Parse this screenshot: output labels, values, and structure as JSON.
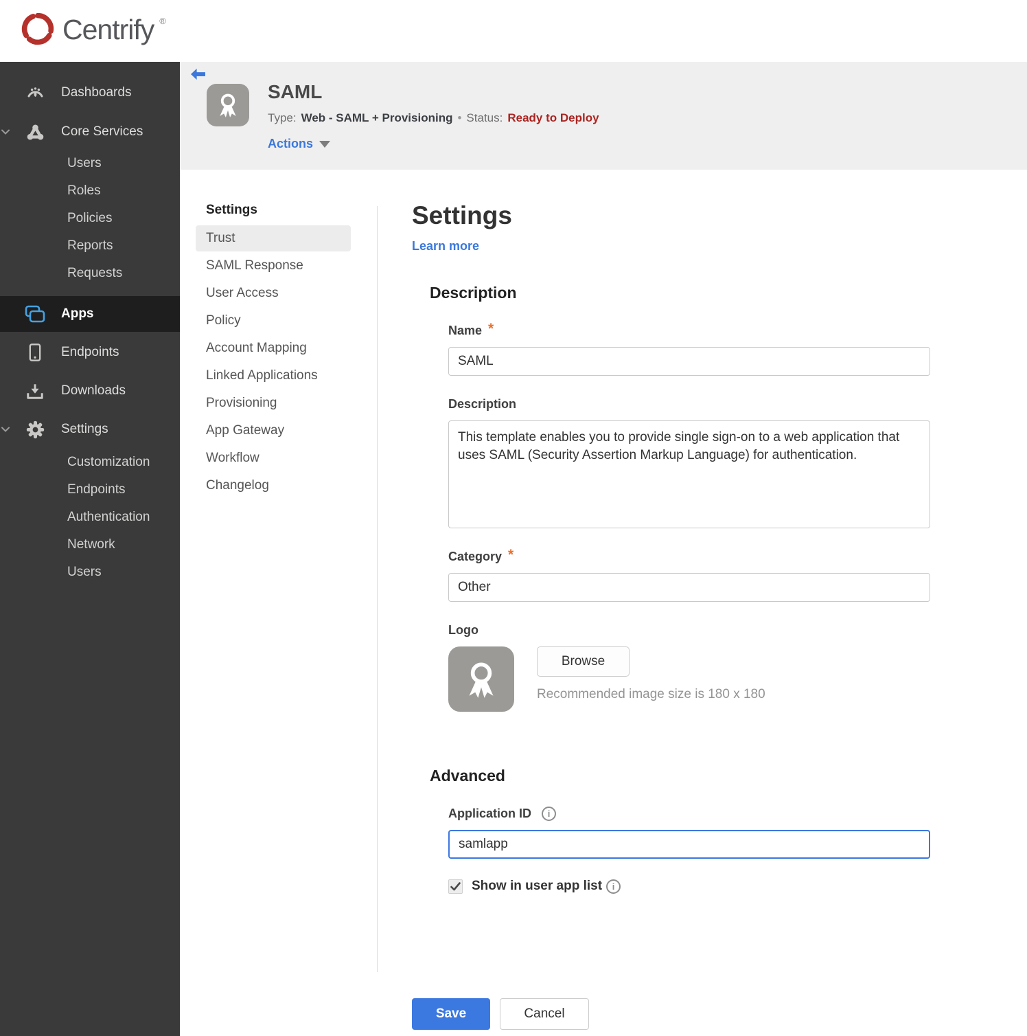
{
  "brand": {
    "name": "Centrify",
    "trademark": "®"
  },
  "sidebar": {
    "items": [
      {
        "label": "Dashboards",
        "icon": "gauge-icon"
      },
      {
        "label": "Core Services",
        "icon": "core-services-icon",
        "expanded": true,
        "children": [
          "Users",
          "Roles",
          "Policies",
          "Reports",
          "Requests"
        ]
      },
      {
        "label": "Apps",
        "icon": "apps-icon",
        "selected": true
      },
      {
        "label": "Endpoints",
        "icon": "endpoints-icon"
      },
      {
        "label": "Downloads",
        "icon": "downloads-icon"
      },
      {
        "label": "Settings",
        "icon": "settings-icon",
        "expanded": true,
        "children": [
          "Customization",
          "Endpoints",
          "Authentication",
          "Network",
          "Users"
        ]
      }
    ]
  },
  "app_header": {
    "title": "SAML",
    "type_label": "Type:",
    "type_value": "Web - SAML + Provisioning",
    "separator": "•",
    "status_label": "Status:",
    "status_value": "Ready to Deploy",
    "actions_label": "Actions"
  },
  "nav": {
    "header": "Settings",
    "selected": "Trust",
    "items": [
      "Trust",
      "SAML Response",
      "User Access",
      "Policy",
      "Account Mapping",
      "Linked Applications",
      "Provisioning",
      "App Gateway",
      "Workflow",
      "Changelog"
    ]
  },
  "main": {
    "title": "Settings",
    "learn_more": "Learn more",
    "description_section": {
      "heading": "Description",
      "name_label": "Name",
      "required_marker": "*",
      "name_value": "SAML",
      "description_label": "Description",
      "description_value": "This template enables you to provide single sign-on to a web application that uses SAML (Security Assertion Markup Language) for authentication.",
      "category_label": "Category",
      "category_value": "Other",
      "logo_label": "Logo",
      "browse_button": "Browse",
      "logo_hint": "Recommended image size is 180 x 180"
    },
    "advanced_section": {
      "heading": "Advanced",
      "application_id_label": "Application ID",
      "application_id_value": "samlapp",
      "show_in_app_list_label": "Show in user app list",
      "checkbox_checked": true
    },
    "save_button": "Save",
    "cancel_button": "Cancel"
  },
  "icons": {
    "info_glyph": "i"
  },
  "colors": {
    "accent_blue": "#3b78e0",
    "link_blue": "#3b78dc",
    "apps_icon_blue": "#45a1e0",
    "status_red": "#a92421",
    "required_orange": "#e8712b",
    "sidebar_bg": "#3a3a3a",
    "sidebar_selected_bg": "#1e1e1e",
    "header_panel_bg": "#f0efef",
    "logo_red": "#b5312c"
  }
}
